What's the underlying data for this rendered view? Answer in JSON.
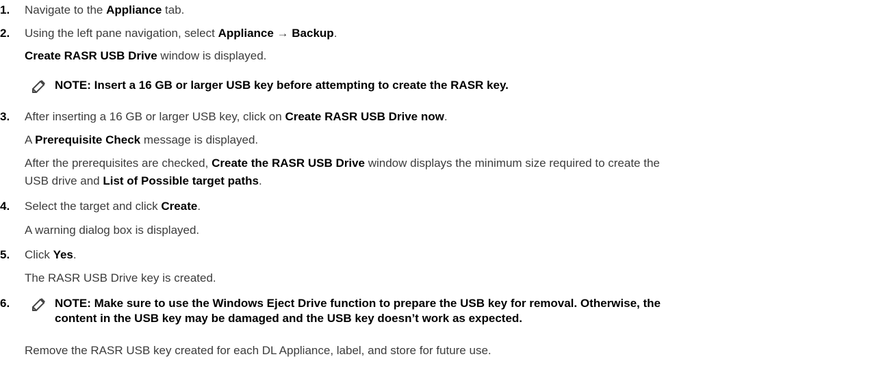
{
  "steps": [
    {
      "num": "1.",
      "pre": "Navigate to the ",
      "b1": "Appliance",
      "post": " tab."
    },
    {
      "num": "2.",
      "pre": "Using the left pane navigation, select ",
      "b1": "Appliance",
      "arrow": " → ",
      "b2": "Backup",
      "post": ".",
      "sub_b": "Create RASR USB Drive",
      "sub_post": " window is displayed."
    },
    {
      "note": "NOTE: Insert a 16 GB or larger USB key before attempting to create the RASR key."
    },
    {
      "num": "3.",
      "pre": "After inserting a 16 GB or larger USB key, click on ",
      "b1": "Create RASR USB Drive now",
      "post": ".",
      "sub1_pre": "A ",
      "sub1_b": "Prerequisite Check",
      "sub1_post": " message is displayed.",
      "sub2_pre": "After the prerequisites are checked, ",
      "sub2_b": "Create the RASR USB Drive",
      "sub2_post": " window displays the minimum size required to create the",
      "sub3_pre": "USB drive and ",
      "sub3_b": "List of Possible target paths",
      "sub3_post": "."
    },
    {
      "num": "4.",
      "pre": "Select the target and click ",
      "b1": "Create",
      "post": ".",
      "sub": "A warning dialog box is displayed."
    },
    {
      "num": "5.",
      "pre": "Click ",
      "b1": "Yes",
      "post": ".",
      "sub": "The RASR USB Drive key is created."
    },
    {
      "num": "6.",
      "note_line1": "NOTE: Make sure to use the Windows Eject Drive function to prepare the USB key for removal. Otherwise, the",
      "note_line2": "content in the USB key may be damaged and the USB key doesn’t work as expected.",
      "sub": "Remove the RASR USB key created for each DL Appliance, label, and store for future use."
    }
  ],
  "icons": {
    "note": "pencil-note-icon"
  }
}
